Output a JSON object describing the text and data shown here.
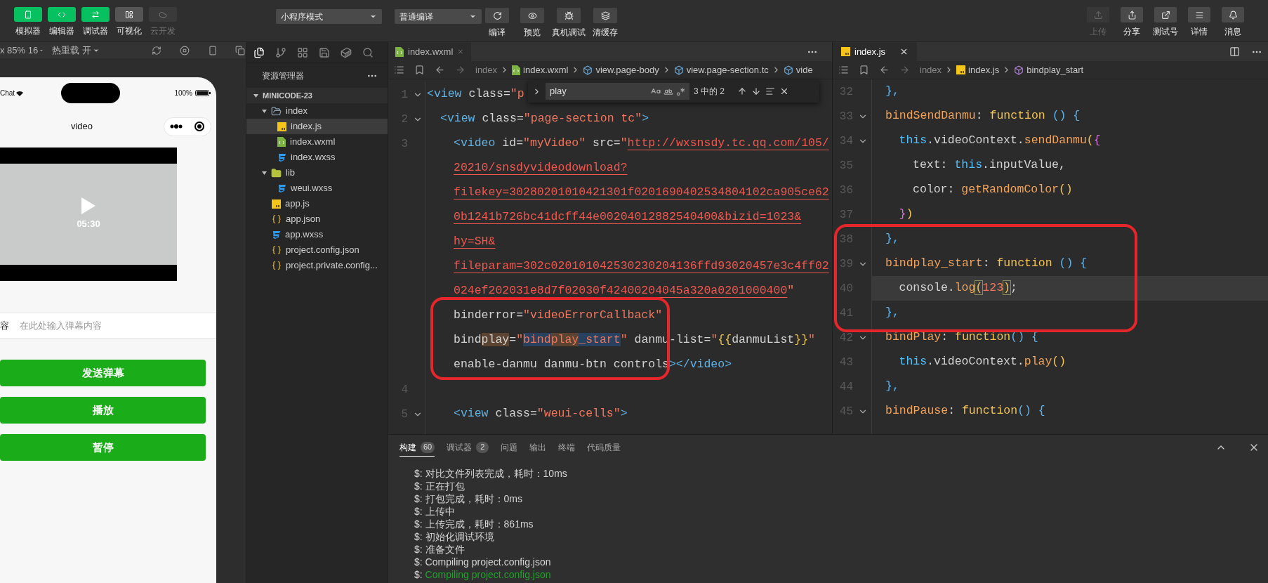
{
  "toolbar": {
    "left_buttons": [
      {
        "label": "模拟器",
        "selected": true,
        "disabled": false
      },
      {
        "label": "编辑器",
        "selected": true,
        "disabled": false
      },
      {
        "label": "调试器",
        "selected": true,
        "disabled": false
      },
      {
        "label": "可视化",
        "selected": false,
        "disabled": false
      },
      {
        "label": "云开发",
        "selected": false,
        "disabled": true
      }
    ],
    "mode_dropdown": "小程序模式",
    "compile_dropdown": "普通编译",
    "actions": [
      {
        "label": "编译"
      },
      {
        "label": "预览"
      },
      {
        "label": "真机调试"
      },
      {
        "label": "清缓存"
      }
    ],
    "right_buttons": [
      {
        "label": "上传",
        "disabled": true
      },
      {
        "label": "分享",
        "disabled": false
      },
      {
        "label": "测试号",
        "disabled": false
      },
      {
        "label": "详情",
        "disabled": false
      },
      {
        "label": "消息",
        "disabled": false
      }
    ]
  },
  "simulator": {
    "device_label": "x 85% 16",
    "hot_reload": "热重载 开",
    "status_left": "Chat",
    "battery": "100%",
    "page_title": "video",
    "video_time": "05:30",
    "input_label": "容",
    "input_placeholder": "在此处输入弹幕内容",
    "buttons": [
      "发送弹幕",
      "播放",
      "暂停"
    ]
  },
  "explorer": {
    "title": "资源管理器",
    "tree": [
      {
        "name": "MINICODE-23",
        "kind": "root",
        "expanded": true,
        "selected": false,
        "children": [
          {
            "name": "index",
            "kind": "folder",
            "expanded": true,
            "selected": false,
            "children": [
              {
                "name": "index.js",
                "kind": "js",
                "selected": true
              },
              {
                "name": "index.wxml",
                "kind": "wxml",
                "selected": false
              },
              {
                "name": "index.wxss",
                "kind": "wxss",
                "selected": false
              }
            ]
          },
          {
            "name": "lib",
            "kind": "library",
            "expanded": true,
            "selected": false,
            "children": [
              {
                "name": "weui.wxss",
                "kind": "wxss",
                "selected": false
              }
            ]
          },
          {
            "name": "app.js",
            "kind": "js",
            "selected": false
          },
          {
            "name": "app.json",
            "kind": "json",
            "selected": false
          },
          {
            "name": "app.wxss",
            "kind": "wxss",
            "selected": false
          },
          {
            "name": "project.config.json",
            "kind": "json",
            "selected": false
          },
          {
            "name": "project.private.config...",
            "kind": "json",
            "selected": false
          }
        ]
      }
    ]
  },
  "left_editor": {
    "tab": {
      "label": "index.wxml",
      "kind": "wxml"
    },
    "breadcrumb": [
      {
        "text": "index",
        "kind": "plain"
      },
      {
        "text": "index.wxml",
        "kind": "wxml"
      },
      {
        "text": "view.page-body",
        "kind": "element"
      },
      {
        "text": "view.page-section.tc",
        "kind": "element"
      },
      {
        "text": "vide",
        "kind": "element"
      }
    ],
    "find": {
      "query": "play",
      "count": "3 中的 2"
    },
    "lines": [
      {
        "number": "1",
        "fold": true,
        "tokens": [
          {
            "text": "<view",
            "kind": "tag"
          },
          {
            "text": " class",
            "kind": "attr"
          },
          {
            "text": "=",
            "kind": "punct"
          },
          {
            "text": "\"p",
            "kind": "str"
          }
        ],
        "children": [
          {
            "number": "2",
            "fold": true,
            "tokens": [
              {
                "text": "<view",
                "kind": "tag"
              },
              {
                "text": " class",
                "kind": "attr"
              },
              {
                "text": "=",
                "kind": "punct"
              },
              {
                "text": "\"page-section tc\"",
                "kind": "str"
              },
              {
                "text": ">",
                "kind": "tag"
              }
            ],
            "children": [
              {
                "number": "3",
                "fold": false,
                "tokens": [
                  {
                    "text": "<video",
                    "kind": "tag"
                  },
                  {
                    "text": " id",
                    "kind": "attr"
                  },
                  {
                    "text": "=",
                    "kind": "punct"
                  },
                  {
                    "text": "\"myVideo\"",
                    "kind": "str"
                  },
                  {
                    "text": " src",
                    "kind": "attr"
                  },
                  {
                    "text": "=",
                    "kind": "punct"
                  },
                  {
                    "text": "\"",
                    "kind": "str"
                  },
                  {
                    "text": "http://wxsnsdy.tc.qq.com/105/",
                    "kind": "url"
                  }
                ]
              },
              {
                "fold": false,
                "tokens": [
                  {
                    "text": "20210/snsdyvideodownload?",
                    "kind": "url"
                  }
                ]
              },
              {
                "fold": false,
                "tokens": [
                  {
                    "text": "filekey=30280201010421301f0201690402534804102ca905ce62",
                    "kind": "url"
                  }
                ]
              },
              {
                "fold": false,
                "tokens": [
                  {
                    "text": "0b1241b726bc41dcff44e00204012882540400&bizid=1023&",
                    "kind": "url"
                  }
                ]
              },
              {
                "fold": false,
                "tokens": [
                  {
                    "text": "hy=SH&",
                    "kind": "url"
                  }
                ]
              },
              {
                "fold": false,
                "tokens": [
                  {
                    "text": "fileparam=302c020101042530230204136ffd93020457e3c4ff02",
                    "kind": "url"
                  }
                ]
              },
              {
                "fold": false,
                "tokens": [
                  {
                    "text": "024ef202031e8d7f02030f42400204045a320a0201000400",
                    "kind": "url"
                  },
                  {
                    "text": "\"",
                    "kind": "str"
                  }
                ]
              },
              {
                "fold": false,
                "tokens": [
                  {
                    "text": "binderror",
                    "kind": "attr"
                  },
                  {
                    "text": "=",
                    "kind": "punct"
                  },
                  {
                    "text": "\"videoErrorCallback\"",
                    "kind": "str"
                  }
                ]
              },
              {
                "fold": false,
                "tokens": [
                  {
                    "text": "bind",
                    "kind": "attr"
                  },
                  {
                    "text": "play",
                    "kind": "attr",
                    "search_match": true
                  },
                  {
                    "text": "=",
                    "kind": "punct"
                  },
                  {
                    "text": "\"",
                    "kind": "str"
                  },
                  {
                    "text": "bind",
                    "kind": "str",
                    "selection": true
                  },
                  {
                    "text": "play",
                    "kind": "str",
                    "search_match": true
                  },
                  {
                    "text": "_start",
                    "kind": "str",
                    "selection": true
                  },
                  {
                    "text": "\"",
                    "kind": "str"
                  },
                  {
                    "text": " danmu-list",
                    "kind": "attr"
                  },
                  {
                    "text": "=",
                    "kind": "punct"
                  },
                  {
                    "text": "\"",
                    "kind": "str"
                  },
                  {
                    "text": "{{",
                    "kind": "mustache"
                  },
                  {
                    "text": "danmuList",
                    "kind": "ident"
                  },
                  {
                    "text": "}}",
                    "kind": "mustache"
                  },
                  {
                    "text": "\"",
                    "kind": "str"
                  }
                ]
              },
              {
                "fold": false,
                "tokens": [
                  {
                    "text": "enable-danmu danmu-btn controls",
                    "kind": "attr"
                  },
                  {
                    "text": "></video>",
                    "kind": "tag"
                  }
                ]
              },
              {
                "number": "4",
                "fold": false
              },
              {
                "number": "5",
                "fold": true,
                "tokens": [
                  {
                    "text": "<view",
                    "kind": "tag"
                  },
                  {
                    "text": " class",
                    "kind": "attr"
                  },
                  {
                    "text": "=",
                    "kind": "punct"
                  },
                  {
                    "text": "\"weui-cells\"",
                    "kind": "str"
                  },
                  {
                    "text": ">",
                    "kind": "tag"
                  }
                ]
              }
            ]
          }
        ]
      }
    ]
  },
  "right_editor": {
    "tab": {
      "label": "index.js",
      "kind": "js"
    },
    "breadcrumb": [
      {
        "text": "index",
        "kind": "plain"
      },
      {
        "text": "index.js",
        "kind": "js"
      },
      {
        "text": "bindplay_start",
        "kind": "method"
      }
    ],
    "lines": [
      {
        "number": "32",
        "fold": false,
        "active": false,
        "tokens": [
          {
            "text": "},",
            "kind": "paren"
          }
        ]
      },
      {
        "number": "33",
        "fold": true,
        "active": false,
        "tokens": [
          {
            "text": "bindSendDanmu",
            "kind": "key"
          },
          {
            "text": ": ",
            "kind": "ident"
          },
          {
            "text": "function",
            "kind": "kw"
          },
          {
            "text": " () {",
            "kind": "paren"
          }
        ],
        "children": [
          {
            "number": "34",
            "fold": true,
            "active": false,
            "tokens": [
              {
                "text": "this",
                "kind": "this"
              },
              {
                "text": ".videoContext.",
                "kind": "ident"
              },
              {
                "text": "sendDanmu",
                "kind": "method"
              },
              {
                "text": "(",
                "kind": "bracket_y"
              },
              {
                "text": "{",
                "kind": "bracket_p"
              }
            ],
            "children": [
              {
                "number": "35",
                "fold": false,
                "active": false,
                "tokens": [
                  {
                    "text": "text: ",
                    "kind": "ident"
                  },
                  {
                    "text": "this",
                    "kind": "this"
                  },
                  {
                    "text": ".inputValue,",
                    "kind": "ident"
                  }
                ]
              },
              {
                "number": "36",
                "fold": false,
                "active": false,
                "tokens": [
                  {
                    "text": "color: ",
                    "kind": "ident"
                  },
                  {
                    "text": "getRandomColor",
                    "kind": "method"
                  },
                  {
                    "text": "()",
                    "kind": "bracket_y"
                  }
                ]
              }
            ]
          },
          {
            "number": "37",
            "fold": false,
            "active": false,
            "tokens": [
              {
                "text": "}",
                "kind": "bracket_p"
              },
              {
                "text": ")",
                "kind": "bracket_y"
              }
            ]
          }
        ]
      },
      {
        "number": "38",
        "fold": false,
        "active": false,
        "tokens": [
          {
            "text": "},",
            "kind": "paren"
          }
        ]
      },
      {
        "number": "39",
        "fold": true,
        "active": false,
        "tokens": [
          {
            "text": "bindplay_start",
            "kind": "key"
          },
          {
            "text": ": ",
            "kind": "ident"
          },
          {
            "text": "function",
            "kind": "kw"
          },
          {
            "text": " () {",
            "kind": "paren"
          }
        ],
        "children": [
          {
            "number": "40",
            "fold": false,
            "active": true,
            "tokens": [
              {
                "text": "console.",
                "kind": "ident"
              },
              {
                "text": "log",
                "kind": "method"
              },
              {
                "text": "(",
                "kind": "bracket_y",
                "bracket_match": true
              },
              {
                "text": "123",
                "kind": "num"
              },
              {
                "text": ")",
                "kind": "bracket_y",
                "bracket_match": true
              },
              {
                "text": ";",
                "kind": "ident"
              }
            ]
          }
        ]
      },
      {
        "number": "41",
        "fold": false,
        "active": false,
        "tokens": [
          {
            "text": "},",
            "kind": "paren"
          }
        ]
      },
      {
        "number": "42",
        "fold": true,
        "active": false,
        "tokens": [
          {
            "text": "bindPlay",
            "kind": "key"
          },
          {
            "text": ": ",
            "kind": "ident"
          },
          {
            "text": "function",
            "kind": "kw"
          },
          {
            "text": "() {",
            "kind": "paren"
          }
        ],
        "children": [
          {
            "number": "43",
            "fold": false,
            "active": false,
            "tokens": [
              {
                "text": "this",
                "kind": "this"
              },
              {
                "text": ".videoContext.",
                "kind": "ident"
              },
              {
                "text": "play",
                "kind": "method"
              },
              {
                "text": "()",
                "kind": "bracket_y"
              }
            ]
          }
        ]
      },
      {
        "number": "44",
        "fold": false,
        "active": false,
        "tokens": [
          {
            "text": "},",
            "kind": "paren"
          }
        ]
      },
      {
        "number": "45",
        "fold": true,
        "active": false,
        "tokens": [
          {
            "text": "bindPause",
            "kind": "key"
          },
          {
            "text": ": ",
            "kind": "ident"
          },
          {
            "text": "function",
            "kind": "kw"
          },
          {
            "text": "() {",
            "kind": "paren"
          }
        ]
      }
    ]
  },
  "console": {
    "tabs": [
      {
        "label": "构建",
        "count": "60",
        "selected": true
      },
      {
        "label": "调试器",
        "count": "2",
        "selected": false
      },
      {
        "label": "问题",
        "selected": false
      },
      {
        "label": "输出",
        "selected": false
      },
      {
        "label": "终端",
        "selected": false
      },
      {
        "label": "代码质量",
        "selected": false
      }
    ],
    "lines": [
      {
        "prompt": "$:",
        "text": "对比文件列表完成，耗时：10ms",
        "kind": "info"
      },
      {
        "prompt": "$:",
        "text": "正在打包",
        "kind": "info"
      },
      {
        "prompt": "$:",
        "text": "打包完成，耗时：0ms",
        "kind": "info"
      },
      {
        "prompt": "$:",
        "text": "上传中",
        "kind": "info"
      },
      {
        "prompt": "$:",
        "text": "上传完成，耗时：861ms",
        "kind": "info"
      },
      {
        "prompt": "$:",
        "text": "初始化调试环境",
        "kind": "info"
      },
      {
        "prompt": "$:",
        "text": "准备文件",
        "kind": "info"
      },
      {
        "prompt": "$:",
        "text": "Compiling project.config.json",
        "kind": "info"
      },
      {
        "prompt": "$:",
        "text": "Compiling project.config.json",
        "kind": "success"
      }
    ]
  }
}
